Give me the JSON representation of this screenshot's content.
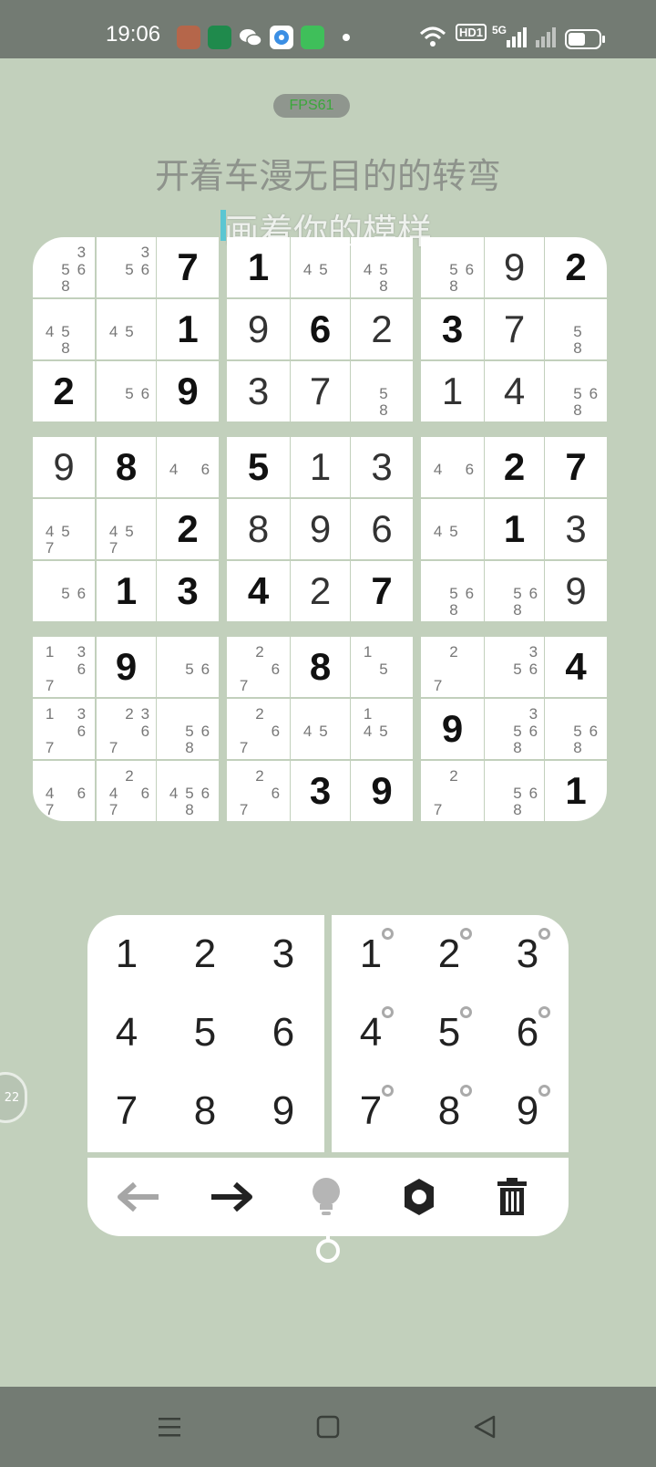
{
  "status_bar": {
    "time": "19:06",
    "hd_badge": "HD1",
    "network": "5G",
    "app_icons": [
      "game-avatar-icon",
      "oppo-icon",
      "wechat-icon",
      "browser-icon",
      "android-market-icon"
    ]
  },
  "overlay": {
    "fps": "FPS61",
    "lyric_line1": "开着车漫无目的的转弯",
    "lyric_line2": "画着你的模样"
  },
  "board": {
    "cells": [
      [
        {
          "n": "3568"
        },
        {
          "n": "356"
        },
        {
          "v": "7",
          "g": true
        },
        {
          "v": "1",
          "g": true
        },
        {
          "n": "45"
        },
        {
          "n": "458"
        },
        {
          "n": "568"
        },
        {
          "v": "9",
          "g": false
        },
        {
          "v": "2",
          "g": true
        }
      ],
      [
        {
          "n": "458"
        },
        {
          "n": "45"
        },
        {
          "v": "1",
          "g": true
        },
        {
          "v": "9",
          "g": false
        },
        {
          "v": "6",
          "g": true
        },
        {
          "v": "2",
          "g": false
        },
        {
          "v": "3",
          "g": true
        },
        {
          "v": "7",
          "g": false
        },
        {
          "n": "58"
        }
      ],
      [
        {
          "v": "2",
          "g": true
        },
        {
          "n": "56"
        },
        {
          "v": "9",
          "g": true
        },
        {
          "v": "3",
          "g": false
        },
        {
          "v": "7",
          "g": false
        },
        {
          "n": "58"
        },
        {
          "v": "1",
          "g": false
        },
        {
          "v": "4",
          "g": false
        },
        {
          "n": "568"
        }
      ],
      [
        {
          "v": "9",
          "g": false
        },
        {
          "v": "8",
          "g": true
        },
        {
          "n": "46"
        },
        {
          "v": "5",
          "g": true
        },
        {
          "v": "1",
          "g": false
        },
        {
          "v": "3",
          "g": false
        },
        {
          "n": "46"
        },
        {
          "v": "2",
          "g": true
        },
        {
          "v": "7",
          "g": true
        }
      ],
      [
        {
          "n": "457"
        },
        {
          "n": "457"
        },
        {
          "v": "2",
          "g": true
        },
        {
          "v": "8",
          "g": false
        },
        {
          "v": "9",
          "g": false
        },
        {
          "v": "6",
          "g": false
        },
        {
          "n": "45"
        },
        {
          "v": "1",
          "g": true
        },
        {
          "v": "3",
          "g": false
        }
      ],
      [
        {
          "n": "56"
        },
        {
          "v": "1",
          "g": true
        },
        {
          "v": "3",
          "g": true
        },
        {
          "v": "4",
          "g": true
        },
        {
          "v": "2",
          "g": false
        },
        {
          "v": "7",
          "g": true
        },
        {
          "n": "568"
        },
        {
          "n": "568"
        },
        {
          "v": "9",
          "g": false
        }
      ],
      [
        {
          "n": "1367"
        },
        {
          "v": "9",
          "g": true
        },
        {
          "n": "56"
        },
        {
          "n": "267"
        },
        {
          "v": "8",
          "g": true
        },
        {
          "n": "15"
        },
        {
          "n": "27"
        },
        {
          "n": "356"
        },
        {
          "v": "4",
          "g": true
        }
      ],
      [
        {
          "n": "1367"
        },
        {
          "n": "2367"
        },
        {
          "n": "568"
        },
        {
          "n": "267"
        },
        {
          "n": "45"
        },
        {
          "n": "145"
        },
        {
          "v": "9",
          "g": true
        },
        {
          "n": "3568"
        },
        {
          "n": "568"
        }
      ],
      [
        {
          "n": "467"
        },
        {
          "n": "2467"
        },
        {
          "n": "4568"
        },
        {
          "n": "267"
        },
        {
          "v": "3",
          "g": true
        },
        {
          "v": "9",
          "g": true
        },
        {
          "n": "27"
        },
        {
          "n": "568"
        },
        {
          "v": "1",
          "g": true
        }
      ]
    ]
  },
  "keypad": {
    "numbers": [
      "1",
      "2",
      "3",
      "4",
      "5",
      "6",
      "7",
      "8",
      "9"
    ],
    "note_numbers": [
      "1",
      "2",
      "3",
      "4",
      "5",
      "6",
      "7",
      "8",
      "9"
    ]
  },
  "toolbar": {
    "icons": [
      "undo-arrow-icon",
      "redo-arrow-icon",
      "hint-bulb-icon",
      "settings-gear-icon",
      "trash-icon"
    ]
  },
  "side_bubble": {
    "label": "22"
  },
  "colors": {
    "background": "#c2d0bc",
    "bars": "#737b73",
    "given_digit": "#111111",
    "note_digit": "#777777"
  }
}
